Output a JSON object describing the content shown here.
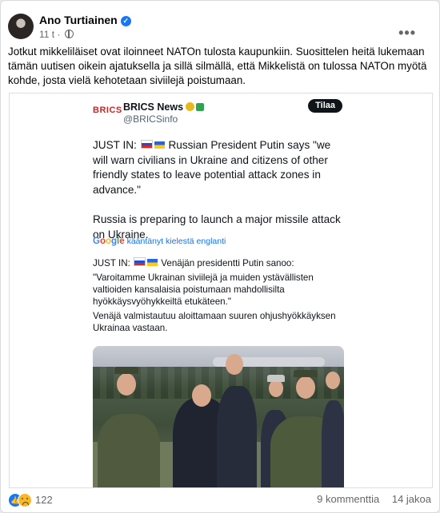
{
  "post": {
    "author": "Ano Turtiainen",
    "time": "11 t",
    "separator": "·",
    "caption": "Jotkut mikkeliläiset ovat iloinneet NATOn tulosta kaupunkiin. Suosittelen heitä lukemaan tämän uutisen oikein ajatuksella ja sillä silmällä, että Mikkelistä on tulossa NATOn myötä kohde, josta vielä kehotetaan siviilejä poistumaan."
  },
  "embed": {
    "logo": "BRICS",
    "name": "BRICS News",
    "handle": "@BRICSinfo",
    "follow_label": "Tilaa",
    "text_line1_prefix": "JUST IN:",
    "text_line1": "Russian President Putin says \"we will warn civilians in Ukraine and citizens of other friendly states to leave potential attack zones in advance.\"",
    "text_line2": "Russia is preparing to launch a major missile attack on Ukraine.",
    "google_brand": "Google",
    "translated_label": "kääntänyt kielestä englanti",
    "fi_prefix": "JUST IN:",
    "fi_line1": "Venäjän presidentti Putin sanoo:",
    "fi_line2": "\"Varoitamme Ukrainan siviilejä ja muiden ystävällisten valtioiden kansalaisia poistumaan mahdollisilta hyökkäysvyöhykkeiltä etukäteen.\"",
    "fi_line3": "Venäjä valmistautuu aloittamaan suuren ohjushyökkäyksen Ukrainaa vastaan."
  },
  "footer": {
    "reaction_count": "122",
    "comments": "9 kommenttia",
    "shares": "14 jakoa"
  },
  "colors": {
    "facebook_blue": "#1877f2",
    "text": "#050505",
    "secondary": "#65676b",
    "google_link": "#1a73e8"
  },
  "icons": [
    "verified-badge-icon",
    "globe-icon",
    "more-options-icon",
    "like-reaction-icon",
    "sad-reaction-icon",
    "google-logo-icon",
    "russia-flag-icon",
    "ukraine-flag-icon"
  ]
}
